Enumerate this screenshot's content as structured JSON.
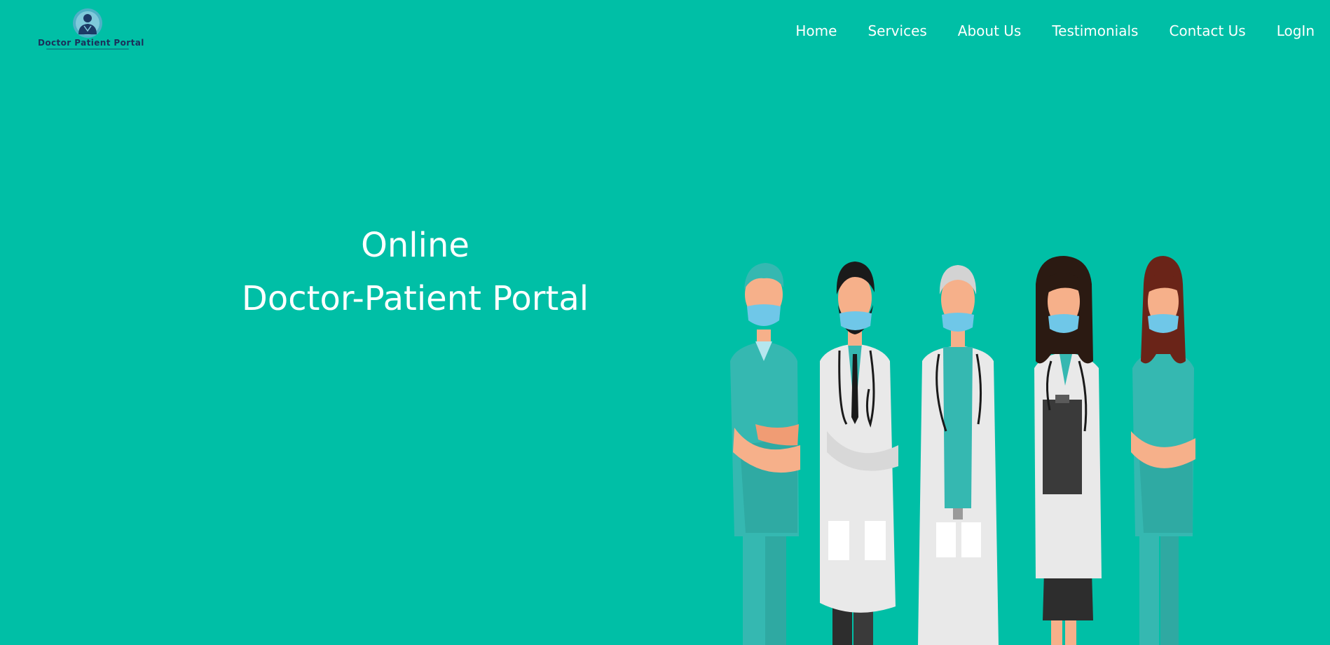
{
  "logo": {
    "text": "Doctor Patient Portal",
    "icon": "doctor-avatar-icon",
    "colors": {
      "ring": "#4fb0c6",
      "figure": "#1b3a66",
      "text": "#1b2f5a"
    }
  },
  "nav": {
    "items": [
      {
        "label": "Home"
      },
      {
        "label": "Services"
      },
      {
        "label": "About Us"
      },
      {
        "label": "Testimonials"
      },
      {
        "label": "Contact Us"
      },
      {
        "label": "LogIn"
      }
    ]
  },
  "hero": {
    "line1": "Online",
    "line2": "Doctor-Patient Portal",
    "illustration": "medical-team-illustration"
  },
  "colors": {
    "background": "#00bfa6",
    "scrubs": "#35b8b1",
    "coat": "#e9e9e9",
    "mask": "#6fc7e8",
    "skin": "#f6b08a"
  }
}
